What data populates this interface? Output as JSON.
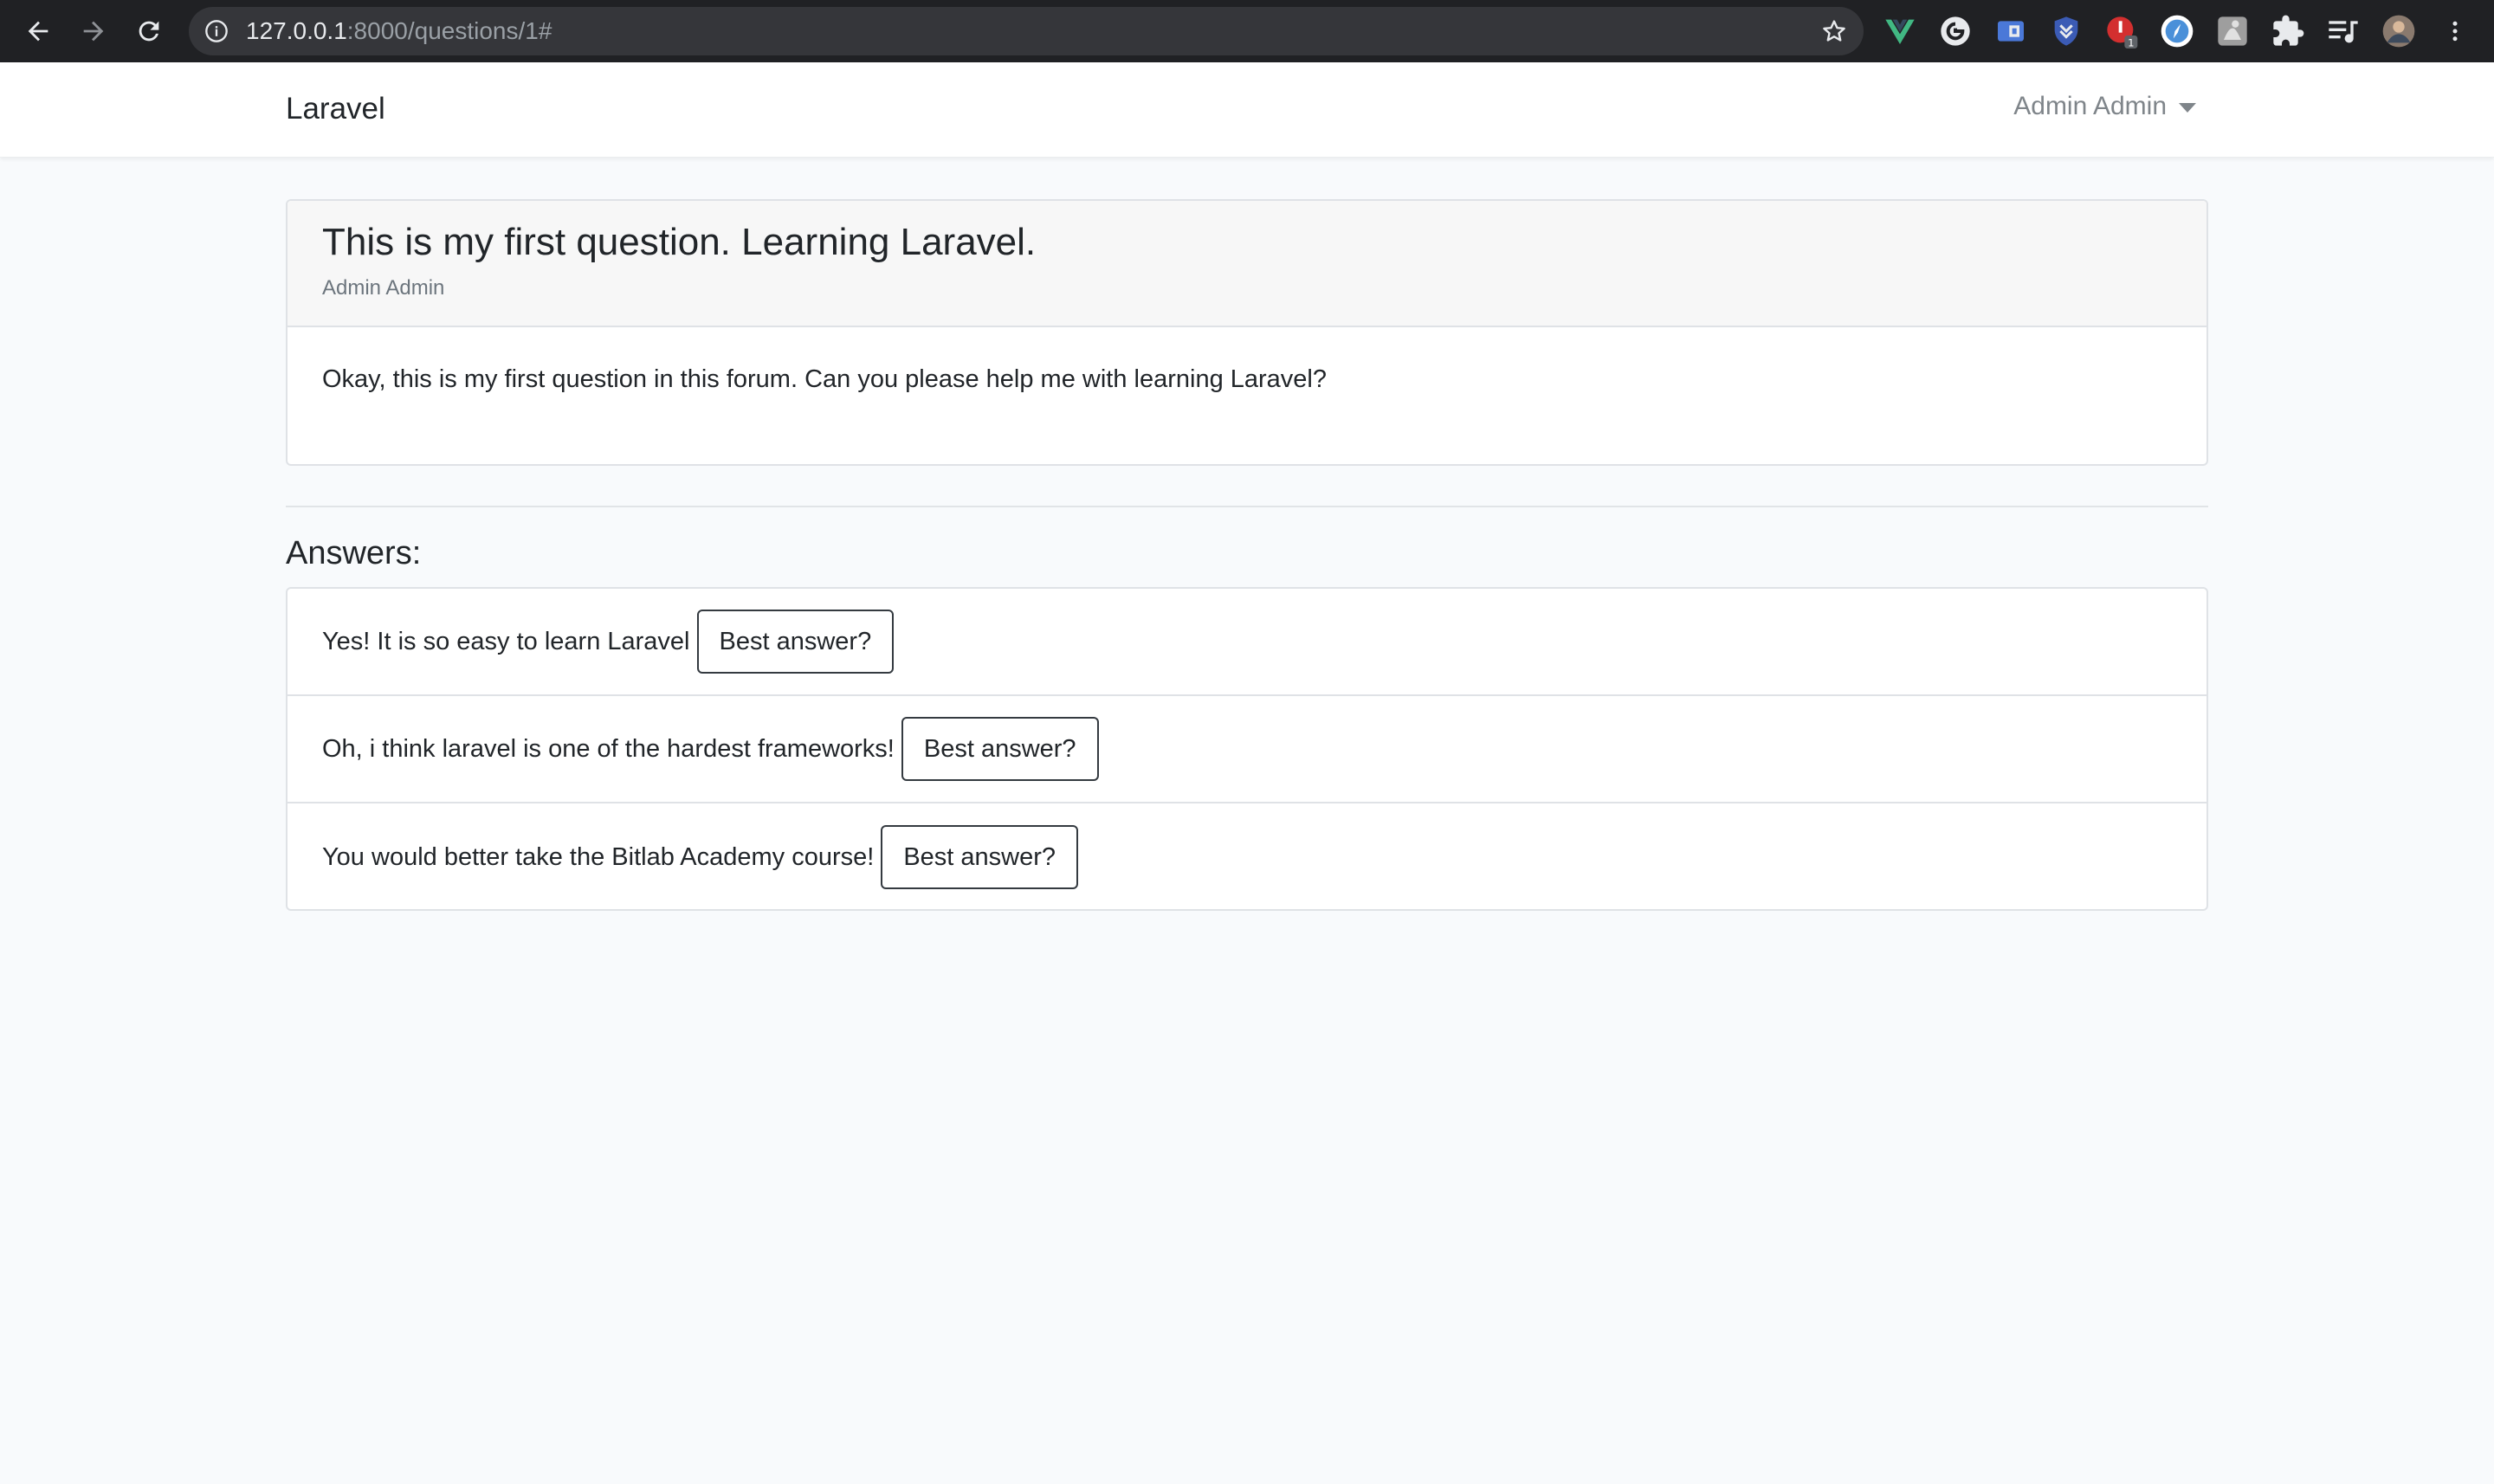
{
  "browser": {
    "url_host": "127.0.0.1",
    "url_rest": ":8000/questions/1#",
    "extensions": [
      "vue-devtools-icon",
      "extension-g-icon",
      "extension-box-icon",
      "extension-shield-icon",
      "extension-red-icon",
      "extension-compass-icon",
      "extension-gray-icon",
      "puzzle-icon",
      "playlist-icon",
      "profile-avatar-icon",
      "more-vert-icon"
    ],
    "badge_count": "1"
  },
  "navbar": {
    "brand": "Laravel",
    "user_name": "Admin Admin"
  },
  "question": {
    "title": "This is my first question. Learning Laravel.",
    "author": "Admin Admin",
    "body": "Okay, this is my first question in this forum. Can you please help me with learning Laravel?"
  },
  "answers": {
    "heading": "Answers:",
    "button_label": "Best answer?",
    "items": [
      {
        "text": "Yes! It is so easy to learn Laravel"
      },
      {
        "text": "Oh, i think laravel is one of the hardest frameworks!"
      },
      {
        "text": "You would better take the Bitlab Academy course!"
      }
    ]
  },
  "colors": {
    "chrome_bg": "#202124",
    "omnibox_bg": "#35363a",
    "page_bg": "#f8fafc",
    "card_border": "#dfe2e6",
    "button_border": "#343a40"
  }
}
